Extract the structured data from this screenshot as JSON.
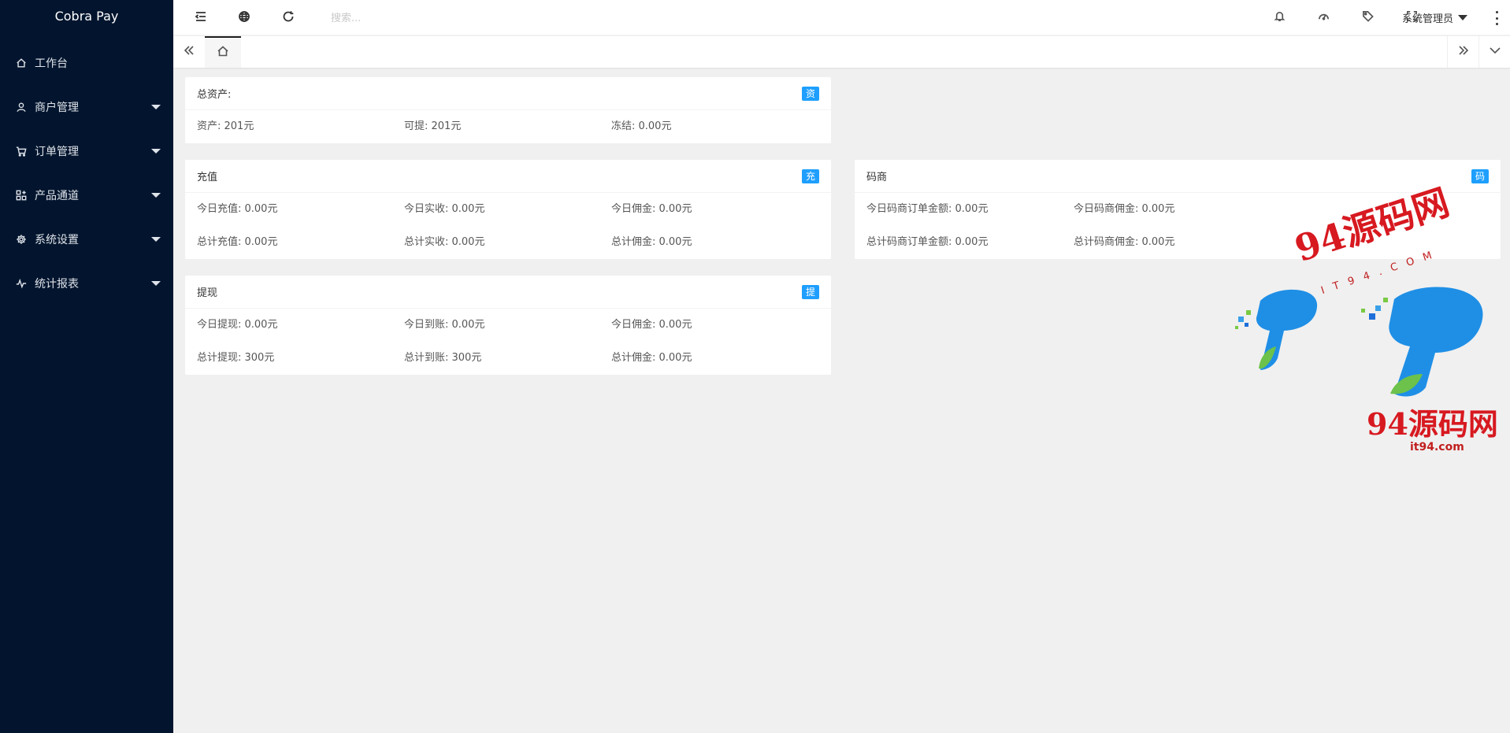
{
  "app": {
    "title": "Cobra Pay"
  },
  "sidebar": {
    "items": [
      {
        "label": "工作台",
        "icon": "home-icon",
        "has_submenu": false
      },
      {
        "label": "商户管理",
        "icon": "user-icon",
        "has_submenu": true
      },
      {
        "label": "订单管理",
        "icon": "cart-icon",
        "has_submenu": true
      },
      {
        "label": "产品通道",
        "icon": "apps-icon",
        "has_submenu": true
      },
      {
        "label": "系统设置",
        "icon": "gear-icon",
        "has_submenu": true
      },
      {
        "label": "统计报表",
        "icon": "pulse-icon",
        "has_submenu": true
      }
    ]
  },
  "header": {
    "search_placeholder": "搜索...",
    "user_name": "系统管理员",
    "icons": [
      "menu-fold-icon",
      "globe-icon",
      "refresh-icon",
      "bell-icon",
      "dashboard-icon",
      "tag-icon",
      "fullscreen-icon",
      "more-vertical-icon"
    ]
  },
  "tabs": {
    "home_icon": "home-icon"
  },
  "cards": {
    "assets": {
      "title": "总资产:",
      "badge": "资",
      "rows": [
        [
          "资产: 201元",
          "可提: 201元",
          "冻结: 0.00元"
        ]
      ]
    },
    "recharge": {
      "title": "充值",
      "badge": "充",
      "rows": [
        [
          "今日充值: 0.00元",
          "今日实收: 0.00元",
          "今日佣金: 0.00元"
        ],
        [
          "总计充值: 0.00元",
          "总计实收: 0.00元",
          "总计佣金: 0.00元"
        ]
      ]
    },
    "merchant": {
      "title": "码商",
      "badge": "码",
      "rows": [
        [
          "今日码商订单金额: 0.00元",
          "今日码商佣金: 0.00元"
        ],
        [
          "总计码商订单金额: 0.00元",
          "总计码商佣金: 0.00元"
        ]
      ]
    },
    "withdraw": {
      "title": "提现",
      "badge": "提",
      "rows": [
        [
          "今日提现: 0.00元",
          "今日到账: 0.00元",
          "今日佣金: 0.00元"
        ],
        [
          "总计提现: 300元",
          "总计到账: 300元",
          "总计佣金: 0.00元"
        ]
      ]
    }
  },
  "watermark": {
    "top_text": "94源码网",
    "top_sub": "IT94.COM",
    "bottom_text": "94源码网",
    "bottom_sub": "it94.com"
  },
  "colors": {
    "sidebar_bg": "#03152e",
    "badge_bg": "#1e9fff",
    "watermark_red": "#d71920",
    "page_bg": "#f0f0f0"
  }
}
